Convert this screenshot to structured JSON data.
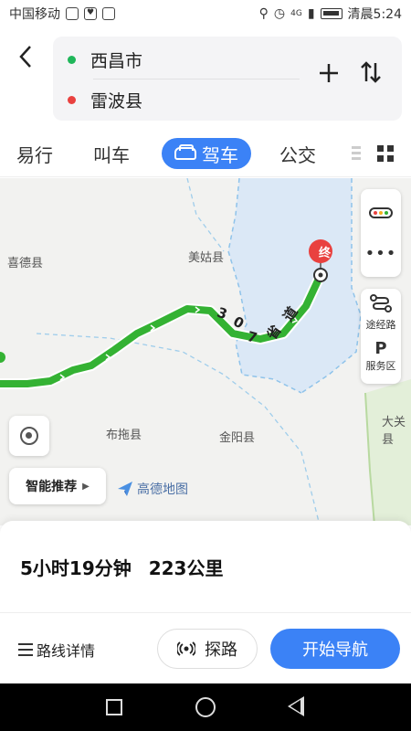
{
  "status_bar": {
    "carrier": "中国移动",
    "time": "清晨5:24",
    "network": "4G"
  },
  "route": {
    "start": "西昌市",
    "end": "雷波县"
  },
  "tabs": [
    {
      "label": "易行",
      "active": false
    },
    {
      "label": "叫车",
      "active": false
    },
    {
      "label": "驾车",
      "active": true
    },
    {
      "label": "公交",
      "active": false
    }
  ],
  "map": {
    "place_labels": [
      "喜德县",
      "美姑县",
      "布拖县",
      "金阳县",
      "大关县"
    ],
    "road_chars": [
      "3",
      "0",
      "7",
      "省",
      "道"
    ],
    "end_marker": "终",
    "controls": {
      "waypoint": "途经路",
      "service": "服务区",
      "service_icon": "P"
    },
    "smart_recommend": "智能推荐",
    "logo_text": "高德地图"
  },
  "summary": {
    "duration": "5小时19分钟",
    "distance": "223公里"
  },
  "actions": {
    "details": "路线详情",
    "explore": "探路",
    "navigate": "开始导航"
  },
  "colors": {
    "accent": "#3b82f6",
    "route": "#34b233",
    "start_dot": "#1fb65a",
    "end_dot": "#e9413f"
  }
}
